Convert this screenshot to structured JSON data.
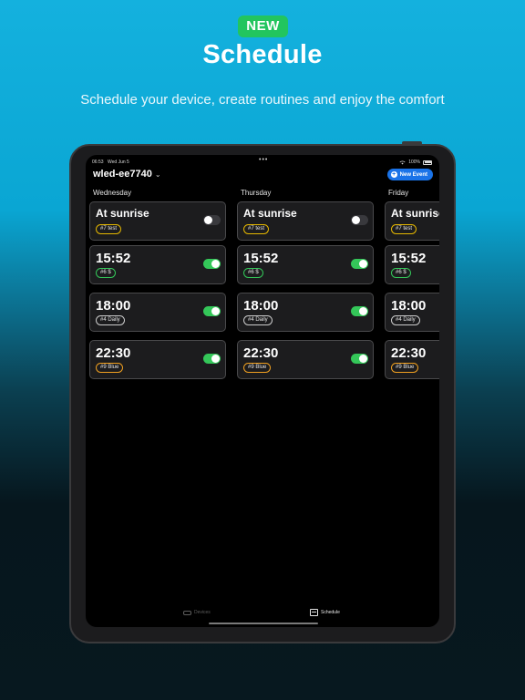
{
  "promo": {
    "badge": "NEW",
    "title": "Schedule",
    "subtitle": "Schedule your device, create routines and enjoy the comfort"
  },
  "status_bar": {
    "time": "06:53",
    "date": "Wed Jun 5",
    "battery": "100%"
  },
  "header": {
    "device_name": "wled-ee7740",
    "new_event_label": "New Event"
  },
  "days": [
    {
      "name": "Wednesday",
      "events": [
        {
          "time": "At sunrise",
          "tag": "#7 test",
          "enabled": false
        },
        {
          "time": "15:52",
          "tag": "#6 $",
          "enabled": true
        },
        {
          "time": "18:00",
          "tag": "#4 Daily",
          "enabled": true
        },
        {
          "time": "22:30",
          "tag": "#9 Blue",
          "enabled": true
        }
      ]
    },
    {
      "name": "Thursday",
      "events": [
        {
          "time": "At sunrise",
          "tag": "#7 test",
          "enabled": false
        },
        {
          "time": "15:52",
          "tag": "#6 $",
          "enabled": true
        },
        {
          "time": "18:00",
          "tag": "#4 Daily",
          "enabled": true
        },
        {
          "time": "22:30",
          "tag": "#9 Blue",
          "enabled": true
        }
      ]
    },
    {
      "name": "Friday",
      "events": [
        {
          "time": "At sunrise",
          "tag": "#7 test",
          "enabled": false
        },
        {
          "time": "15:52",
          "tag": "#6 $",
          "enabled": true
        },
        {
          "time": "18:00",
          "tag": "#4 Daily",
          "enabled": true
        },
        {
          "time": "22:30",
          "tag": "#9 Blue",
          "enabled": true
        }
      ]
    }
  ],
  "tab_bar": {
    "devices_label": "Devices",
    "schedule_label": "Schedule"
  },
  "colors": {
    "badge": "#22c55e",
    "accent_blue": "#1a73e8",
    "toggle_on": "#34c759",
    "tag_sunrise": "#e6b800",
    "tag_dollar": "#34c759",
    "tag_daily": "#cccccc",
    "tag_blue": "#f0a020"
  }
}
